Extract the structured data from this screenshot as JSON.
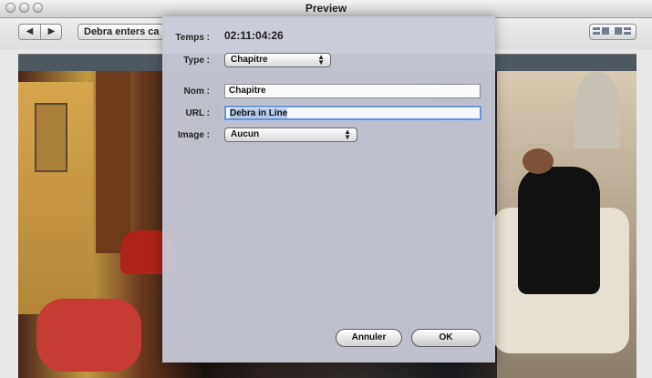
{
  "window": {
    "title": "Preview"
  },
  "toolbar": {
    "chapter_text": "Debra enters ca",
    "nav_back_label": "◀",
    "nav_forward_label": "▶",
    "right_tools": [
      "view-icon-1",
      "view-icon-2"
    ]
  },
  "dialog": {
    "fields": {
      "temps_label": "Temps :",
      "temps_value": "02:11:04:26",
      "type_label": "Type :",
      "type_value": "Chapitre",
      "nom_label": "Nom :",
      "nom_value": "Chapitre",
      "url_label": "URL :",
      "url_value": "Debra in Line",
      "image_label": "Image :",
      "image_value": "Aucun"
    },
    "buttons": {
      "cancel": "Annuler",
      "ok": "OK"
    }
  }
}
